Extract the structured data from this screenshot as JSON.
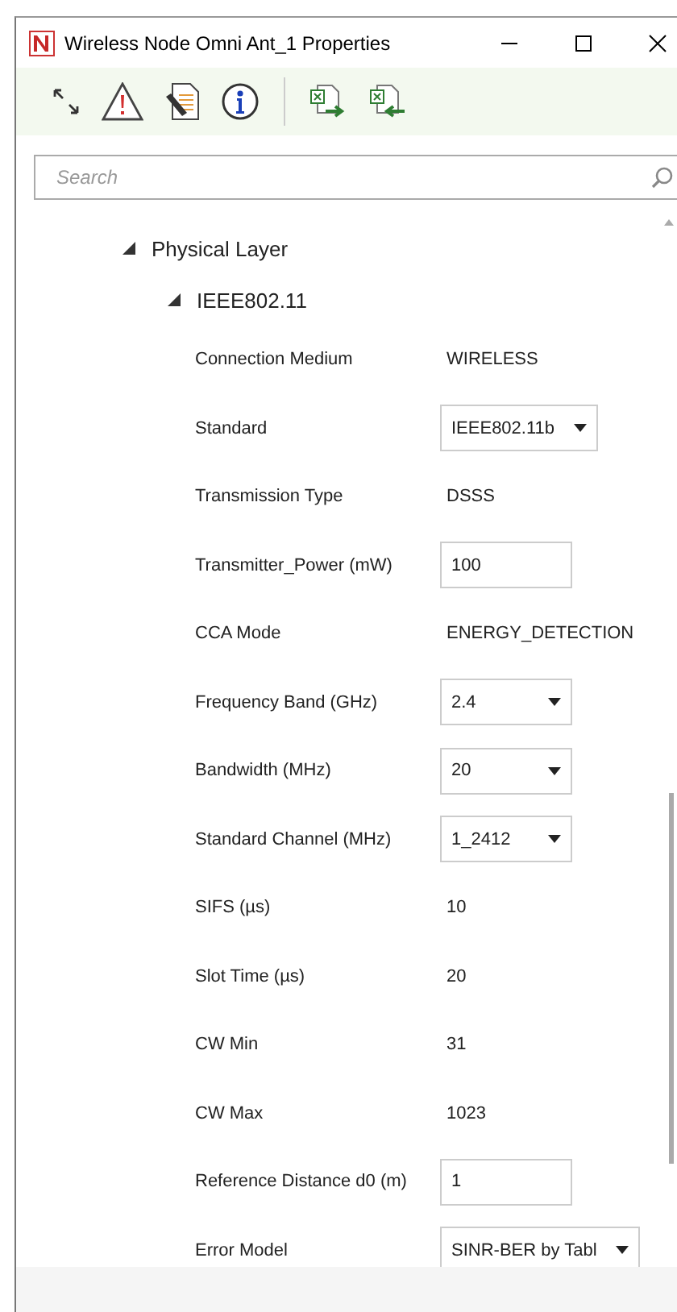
{
  "window": {
    "title": "Wireless Node Omni Ant_1 Properties"
  },
  "search": {
    "placeholder": "Search"
  },
  "tree": [
    {
      "label": "Physical Layer",
      "expanded": true,
      "children": [
        {
          "label": "IEEE802.11",
          "expanded": true,
          "properties": [
            {
              "kind": "text",
              "label": "Connection Medium",
              "value": "WIRELESS"
            },
            {
              "kind": "dropdown",
              "label": "Standard",
              "value": "IEEE802.11b"
            },
            {
              "kind": "text",
              "label": "Transmission Type",
              "value": "DSSS"
            },
            {
              "kind": "input",
              "label": "Transmitter_Power (mW)",
              "value": "100"
            },
            {
              "kind": "text",
              "label": "CCA Mode",
              "value": "ENERGY_DETECTION"
            },
            {
              "kind": "dropdown",
              "label": "Frequency Band (GHz)",
              "value": "2.4"
            },
            {
              "kind": "dropdown",
              "label": "Bandwidth (MHz)",
              "value": "20"
            },
            {
              "kind": "dropdown",
              "label": "Standard Channel (MHz)",
              "value": "1_2412"
            },
            {
              "kind": "text",
              "label": "SIFS (µs)",
              "value": "10"
            },
            {
              "kind": "text",
              "label": "Slot Time (µs)",
              "value": "20"
            },
            {
              "kind": "text",
              "label": "CW Min",
              "value": "31"
            },
            {
              "kind": "text",
              "label": "CW Max",
              "value": "1023"
            },
            {
              "kind": "input",
              "label": "Reference Distance d0 (m)",
              "value": "1"
            },
            {
              "kind": "dropdown",
              "label": "Error Model",
              "value": "SINR-BER by Tabl"
            }
          ]
        }
      ]
    }
  ]
}
